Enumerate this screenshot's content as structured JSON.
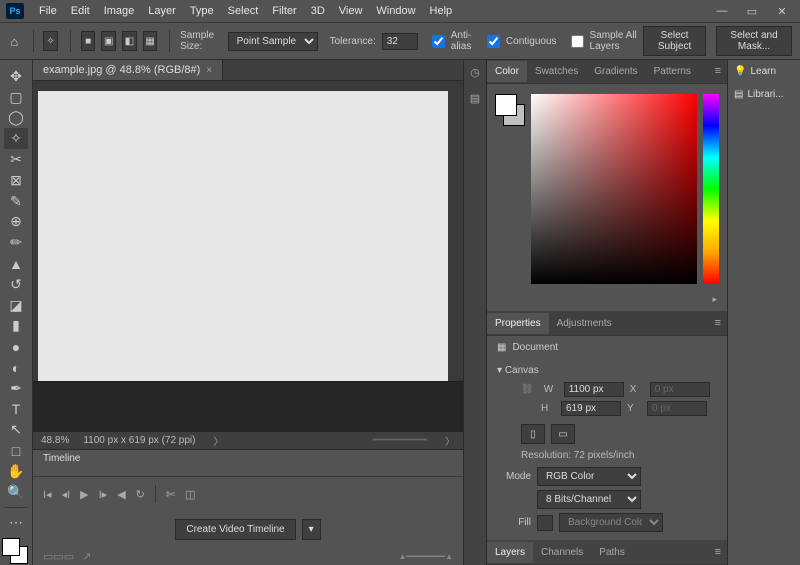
{
  "menubar": {
    "items": [
      "File",
      "Edit",
      "Image",
      "Layer",
      "Type",
      "Select",
      "Filter",
      "3D",
      "View",
      "Window",
      "Help"
    ]
  },
  "optbar": {
    "sample_size_label": "Sample Size:",
    "sample_size_value": "Point Sample",
    "tolerance_label": "Tolerance:",
    "tolerance_value": "32",
    "antialias": "Anti-alias",
    "contiguous": "Contiguous",
    "sample_all": "Sample All Layers",
    "select_subject": "Select Subject",
    "select_mask": "Select and Mask..."
  },
  "doc": {
    "tab_label": "example.jpg @ 48.8% (RGB/8#)"
  },
  "status": {
    "zoom": "48.8%",
    "dims": "1100 px x 619 px (72 ppi)"
  },
  "timeline": {
    "title": "Timeline",
    "create_btn": "Create Video Timeline"
  },
  "color_panel": {
    "tabs": [
      "Color",
      "Swatches",
      "Gradients",
      "Patterns"
    ]
  },
  "right": {
    "learn": "Learn",
    "libraries": "Librari..."
  },
  "props": {
    "tabs": [
      "Properties",
      "Adjustments"
    ],
    "document": "Document",
    "canvas": "Canvas",
    "W": "W",
    "H": "H",
    "X": "X",
    "Y": "Y",
    "w_val": "1100 px",
    "h_val": "619 px",
    "x_val": "0 px",
    "y_val": "0 px",
    "resolution": "Resolution: 72 pixels/inch",
    "mode_label": "Mode",
    "mode": "RGB Color",
    "depth": "8 Bits/Channel",
    "fill_label": "Fill",
    "fill": "Background Color"
  },
  "layers": {
    "tabs": [
      "Layers",
      "Channels",
      "Paths"
    ]
  }
}
